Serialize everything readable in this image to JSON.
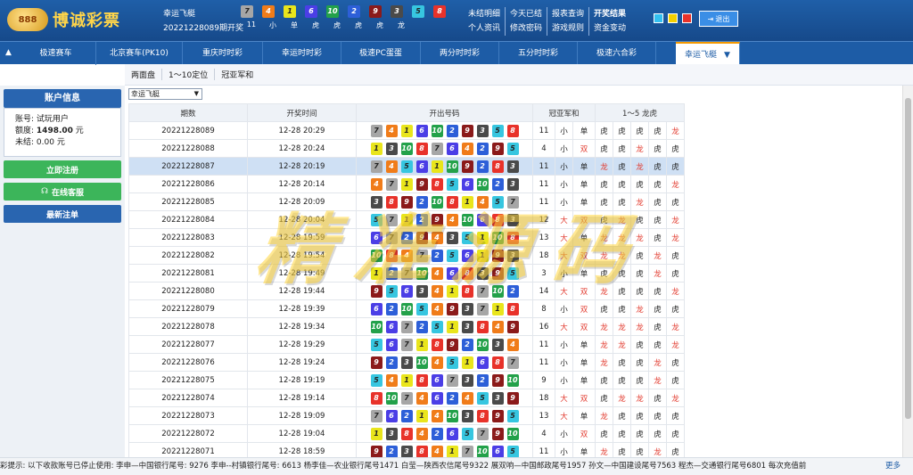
{
  "brand": {
    "logo_mark": "888",
    "name": "博诚彩票"
  },
  "current": {
    "lottery": "幸运飞艇",
    "draw_label": "20221228089期开奖",
    "balls": [
      7,
      4,
      1,
      6,
      10,
      2,
      9,
      3,
      5,
      8
    ],
    "stats": [
      "11",
      "小",
      "单",
      "虎",
      "虎",
      "虎",
      "虎",
      "龙"
    ]
  },
  "top_links": {
    "row1": [
      "未结明细",
      "今天已结",
      "报表查询",
      "开奖结果"
    ],
    "row2": [
      "个人资讯",
      "修改密码",
      "游戏规则",
      "资金变动"
    ]
  },
  "logout_label": "退出",
  "nav": {
    "tabs": [
      "极速赛车",
      "北京赛车(PK10)",
      "重庆时时彩",
      "幸运时时彩",
      "极速PC蛋蛋",
      "两分时时彩",
      "五分时时彩",
      "极速六合彩",
      "幸运飞艇"
    ],
    "active_index": 8,
    "active_caret": "▼"
  },
  "subnav": [
    "两面盘",
    "1～10定位",
    "冠亚军和"
  ],
  "sidebar": {
    "title": "账户信息",
    "account_label": "账号:",
    "account_value": "试玩用户",
    "quota_label": "额度:",
    "quota_value": "1498.00",
    "quota_unit": "元",
    "unsettled_label": "未结:",
    "unsettled_value": "0.00",
    "unsettled_unit": "元",
    "register_label": "立即注册",
    "service_label": "在线客服",
    "latest_label": "最新注单"
  },
  "selector": {
    "value": "幸运飞艇"
  },
  "table": {
    "headers": {
      "issue": "期数",
      "time": "开奖时间",
      "numbers": "开出号码",
      "sum": "冠亚军和",
      "dt": "1～5 龙虎"
    },
    "highlight_index": 2,
    "rows": [
      {
        "issue": "20221228089",
        "time": "12-28 20:29",
        "balls": [
          7,
          4,
          1,
          6,
          10,
          2,
          9,
          3,
          5,
          8
        ],
        "sum": "11",
        "size": "小",
        "parity": "单",
        "dt": [
          "虎",
          "虎",
          "虎",
          "虎",
          "龙"
        ]
      },
      {
        "issue": "20221228088",
        "time": "12-28 20:24",
        "balls": [
          1,
          3,
          10,
          8,
          7,
          6,
          4,
          2,
          9,
          5
        ],
        "sum": "4",
        "size": "小",
        "parity": "双",
        "dt": [
          "虎",
          "虎",
          "龙",
          "虎",
          "虎"
        ]
      },
      {
        "issue": "20221228087",
        "time": "12-28 20:19",
        "balls": [
          7,
          4,
          5,
          6,
          1,
          10,
          9,
          2,
          8,
          3
        ],
        "sum": "11",
        "size": "小",
        "parity": "单",
        "dt": [
          "龙",
          "虎",
          "龙",
          "虎",
          "虎"
        ]
      },
      {
        "issue": "20221228086",
        "time": "12-28 20:14",
        "balls": [
          4,
          7,
          1,
          9,
          8,
          5,
          6,
          10,
          2,
          3
        ],
        "sum": "11",
        "size": "小",
        "parity": "单",
        "dt": [
          "虎",
          "虎",
          "虎",
          "虎",
          "龙"
        ]
      },
      {
        "issue": "20221228085",
        "time": "12-28 20:09",
        "balls": [
          3,
          8,
          9,
          2,
          10,
          8,
          1,
          4,
          5,
          7
        ],
        "sum": "11",
        "size": "小",
        "parity": "单",
        "dt": [
          "虎",
          "虎",
          "龙",
          "虎",
          "虎"
        ]
      },
      {
        "issue": "20221228084",
        "time": "12-28 20:04",
        "balls": [
          5,
          7,
          1,
          2,
          9,
          4,
          10,
          6,
          8,
          3
        ],
        "sum": "12",
        "size": "大",
        "parity": "双",
        "dt": [
          "虎",
          "龙",
          "虎",
          "虎",
          "龙"
        ]
      },
      {
        "issue": "20221228083",
        "time": "12-28 19:59",
        "balls": [
          6,
          7,
          2,
          9,
          4,
          3,
          5,
          1,
          10,
          8
        ],
        "sum": "13",
        "size": "大",
        "parity": "单",
        "dt": [
          "龙",
          "龙",
          "龙",
          "虎",
          "龙"
        ]
      },
      {
        "issue": "20221228082",
        "time": "12-28 19:54",
        "balls": [
          10,
          8,
          4,
          7,
          2,
          5,
          6,
          1,
          9,
          3
        ],
        "sum": "18",
        "size": "大",
        "parity": "双",
        "dt": [
          "龙",
          "龙",
          "虎",
          "龙",
          "虎"
        ]
      },
      {
        "issue": "20221228081",
        "time": "12-28 19:49",
        "balls": [
          1,
          2,
          7,
          10,
          4,
          6,
          8,
          3,
          9,
          5
        ],
        "sum": "3",
        "size": "小",
        "parity": "单",
        "dt": [
          "虎",
          "虎",
          "虎",
          "龙",
          "虎"
        ]
      },
      {
        "issue": "20221228080",
        "time": "12-28 19:44",
        "balls": [
          9,
          5,
          6,
          3,
          4,
          1,
          8,
          7,
          10,
          2
        ],
        "sum": "14",
        "size": "大",
        "parity": "双",
        "dt": [
          "龙",
          "虎",
          "虎",
          "虎",
          "龙"
        ]
      },
      {
        "issue": "20221228079",
        "time": "12-28 19:39",
        "balls": [
          6,
          2,
          10,
          5,
          4,
          9,
          3,
          7,
          1,
          8
        ],
        "sum": "8",
        "size": "小",
        "parity": "双",
        "dt": [
          "虎",
          "虎",
          "龙",
          "虎",
          "虎"
        ]
      },
      {
        "issue": "20221228078",
        "time": "12-28 19:34",
        "balls": [
          10,
          6,
          7,
          2,
          5,
          1,
          3,
          8,
          4,
          9
        ],
        "sum": "16",
        "size": "大",
        "parity": "双",
        "dt": [
          "龙",
          "龙",
          "龙",
          "虎",
          "龙"
        ]
      },
      {
        "issue": "20221228077",
        "time": "12-28 19:29",
        "balls": [
          5,
          6,
          7,
          1,
          8,
          9,
          2,
          10,
          3,
          4
        ],
        "sum": "11",
        "size": "小",
        "parity": "单",
        "dt": [
          "龙",
          "龙",
          "虎",
          "虎",
          "龙"
        ]
      },
      {
        "issue": "20221228076",
        "time": "12-28 19:24",
        "balls": [
          9,
          2,
          3,
          10,
          4,
          5,
          1,
          6,
          8,
          7
        ],
        "sum": "11",
        "size": "小",
        "parity": "单",
        "dt": [
          "龙",
          "虎",
          "虎",
          "龙",
          "虎"
        ]
      },
      {
        "issue": "20221228075",
        "time": "12-28 19:19",
        "balls": [
          5,
          4,
          1,
          8,
          6,
          7,
          3,
          2,
          9,
          10
        ],
        "sum": "9",
        "size": "小",
        "parity": "单",
        "dt": [
          "虎",
          "虎",
          "虎",
          "龙",
          "虎"
        ]
      },
      {
        "issue": "20221228074",
        "time": "12-28 19:14",
        "balls": [
          8,
          10,
          7,
          4,
          6,
          2,
          4,
          5,
          3,
          9
        ],
        "sum": "18",
        "size": "大",
        "parity": "双",
        "dt": [
          "虎",
          "龙",
          "龙",
          "虎",
          "龙"
        ]
      },
      {
        "issue": "20221228073",
        "time": "12-28 19:09",
        "balls": [
          7,
          6,
          2,
          1,
          4,
          10,
          3,
          8,
          9,
          5
        ],
        "sum": "13",
        "size": "大",
        "parity": "单",
        "dt": [
          "龙",
          "虎",
          "虎",
          "虎",
          "虎"
        ]
      },
      {
        "issue": "20221228072",
        "time": "12-28 19:04",
        "balls": [
          1,
          3,
          8,
          4,
          2,
          6,
          5,
          7,
          9,
          10
        ],
        "sum": "4",
        "size": "小",
        "parity": "双",
        "dt": [
          "虎",
          "虎",
          "虎",
          "虎",
          "虎"
        ]
      },
      {
        "issue": "20221228071",
        "time": "12-28 18:59",
        "balls": [
          9,
          2,
          3,
          8,
          4,
          1,
          7,
          10,
          6,
          5
        ],
        "sum": "11",
        "size": "小",
        "parity": "单",
        "dt": [
          "龙",
          "虎",
          "虎",
          "龙",
          "虎"
        ]
      }
    ]
  },
  "watermark_text": "精准源码",
  "ticker": {
    "text": "彩提示:  以下收款账号已停止使用:  李申—中国银行尾号: 9276 李申--村镇银行尾号: 6613 杨李佳—农业银行尾号1471 白莹—陕西农信尾号9322 展双响—中国邮政尾号1957 孙文—中国建设尾号7563 程杰—交通银行尾号6801 每次充值前",
    "more": "更多"
  },
  "colors": {
    "ball_1": "#e9e51c",
    "ball_2": "#2d5fd8",
    "ball_3": "#4a4a4a",
    "ball_4": "#f07c1a",
    "ball_5": "#37c6e0",
    "ball_6": "#4b3ee6",
    "ball_7": "#a6a6a6",
    "ball_8": "#e8322a",
    "ball_9": "#8b1a1a",
    "ball_10": "#23a14a",
    "header": "#1d5ca6",
    "red": "#e23a2e",
    "green": "#3cb55a"
  }
}
